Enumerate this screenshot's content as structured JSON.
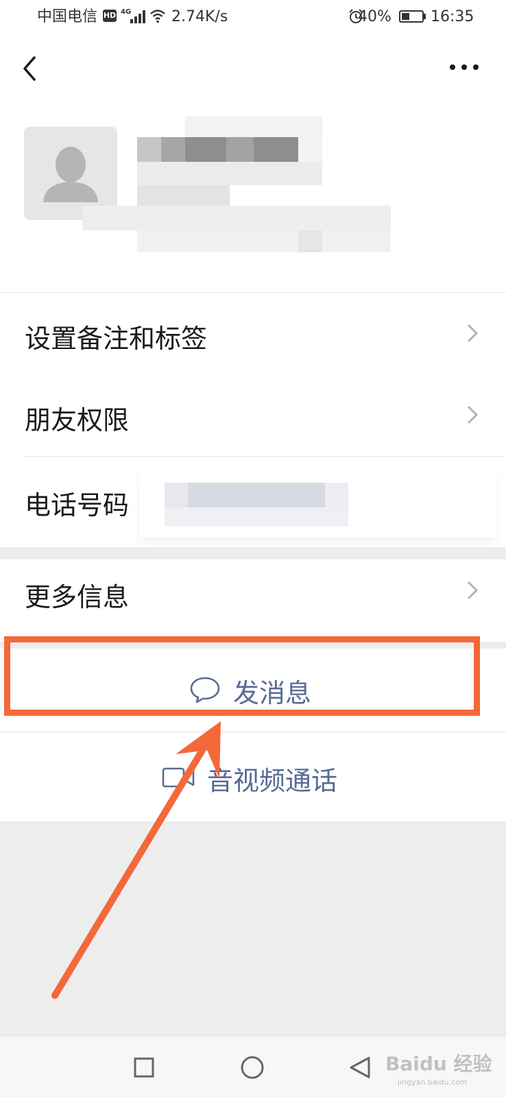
{
  "status_bar": {
    "carrier": "中国电信",
    "hd": "HD",
    "network": "4G",
    "speed": "2.74K/s",
    "battery_percent": "40%",
    "battery_level": 0.4,
    "time": "16:35"
  },
  "header": {
    "back_icon": "chevron-left-icon",
    "more_icon": "more-dots-icon"
  },
  "profile": {
    "avatar_icon": "person-placeholder-icon"
  },
  "menu": {
    "items": [
      {
        "label": "设置备注和标签"
      },
      {
        "label": "朋友权限"
      },
      {
        "label": "电话号码"
      },
      {
        "label": "更多信息"
      }
    ]
  },
  "actions": {
    "send_message": "发消息",
    "video_call": "音视频通话"
  },
  "watermark": {
    "brand": "Baidu 经验",
    "url": "jingyan.baidu.com"
  },
  "colors": {
    "accent_link": "#576b95",
    "annotation": "#f4683a",
    "background": "#ededed"
  }
}
